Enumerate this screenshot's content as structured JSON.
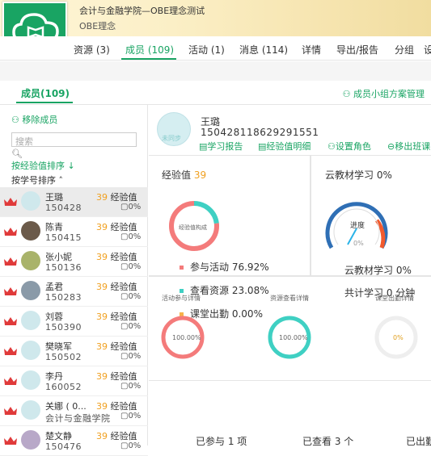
{
  "course": {
    "title": "会计与金融学院—OBE理念测试",
    "subtitle": "OBE理念"
  },
  "tabs": [
    "资源 (3)",
    "成员 (109)",
    "活动 (1)",
    "消息 (114)",
    "详情",
    "导出/报告",
    "分组",
    "设"
  ],
  "members": {
    "title": "成员(109)",
    "group_manage": "⚇ 成员小组方案管理",
    "remove": "⚇ 移除成员",
    "search_placeholder": "搜索",
    "sort_exp": "按经验值排序 ↓",
    "sort_id": "按学号排序 ˄"
  },
  "rows": [
    {
      "name": "王璐",
      "id": "150428",
      "exp": "39",
      "exp_label": "经验值",
      "pct": "▢0%"
    },
    {
      "name": "陈青",
      "id": "150415",
      "exp": "39",
      "exp_label": "经验值",
      "pct": "▢0%"
    },
    {
      "name": "张小妮",
      "id": "150136",
      "exp": "39",
      "exp_label": "经验值",
      "pct": "▢0%"
    },
    {
      "name": "孟君",
      "id": "150283",
      "exp": "39",
      "exp_label": "经验值",
      "pct": "▢0%"
    },
    {
      "name": "刘蓉",
      "id": "150390",
      "exp": "39",
      "exp_label": "经验值",
      "pct": "▢0%"
    },
    {
      "name": "樊晓军",
      "id": "150502",
      "exp": "39",
      "exp_label": "经验值",
      "pct": "▢0%"
    },
    {
      "name": "李丹",
      "id": "160052",
      "exp": "39",
      "exp_label": "经验值",
      "pct": "▢0%"
    },
    {
      "name": "关娜 ( 0...",
      "id": "会计与金融学院",
      "exp": "39",
      "exp_label": "经验值",
      "pct": "▢0%"
    },
    {
      "name": "楚文静",
      "id": "150476",
      "exp": "39",
      "exp_label": "经验值",
      "pct": "▢0%"
    }
  ],
  "profile": {
    "name": "王璐",
    "id": "150428118629291551",
    "badge": "未同步",
    "links": [
      "▤学习报告",
      "▤经验值明细",
      "⚇设置角色",
      "⊖移出班课"
    ]
  },
  "exp": {
    "label": "经验值",
    "value": "39",
    "ring_text": "经验值构成"
  },
  "legend": [
    {
      "label": "参与活动",
      "value": "76.92%",
      "color": "#f47b7b"
    },
    {
      "label": "查看资源",
      "value": "23.08%",
      "color": "#3fd0c3"
    },
    {
      "label": "课堂出勤",
      "value": "0.00%",
      "color": "#f7b24a"
    }
  ],
  "cloud": {
    "label": "云教材学习",
    "value": "0%",
    "gauge_label": "进度",
    "gauge_pct": "0%",
    "footer": "云教材学习 0%"
  },
  "cowork": "共计学习 0 分钟",
  "details": [
    "活动参与详情",
    "资源查看详情",
    "课堂出勤详情"
  ],
  "rings": [
    {
      "text": "100.00%",
      "color": "#f47b7b"
    },
    {
      "text": "100.00%",
      "color": "#3fd0c3"
    },
    {
      "text": "0%",
      "color": "#eeeeee"
    }
  ],
  "footer": [
    "已参与 1 项",
    "已查看 3 个",
    "已出勤"
  ]
}
